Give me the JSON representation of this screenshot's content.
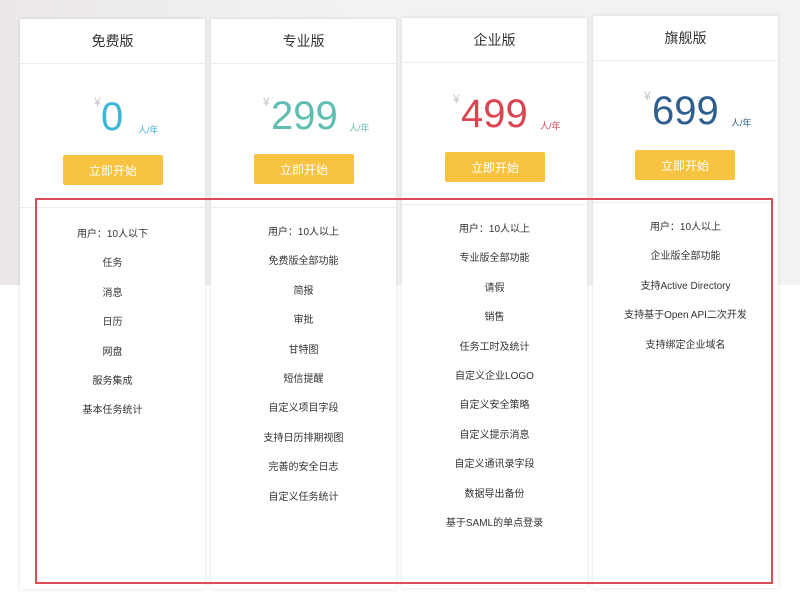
{
  "colors": {
    "free": "#3bb5d8",
    "pro": "#5fbdb1",
    "enterprise": "#d94652",
    "flagship": "#2d5f8f",
    "button": "#f7c341",
    "highlight_border": "#db4c58"
  },
  "plans": [
    {
      "name": "免费版",
      "currency": "¥",
      "price": "0",
      "unit": "人/年",
      "cta": "立即开始",
      "features": [
        "用户：10人以下",
        "任务",
        "消息",
        "日历",
        "网盘",
        "服务集成",
        "基本任务统计"
      ]
    },
    {
      "name": "专业版",
      "currency": "¥",
      "price": "299",
      "unit": "人/年",
      "cta": "立即开始",
      "features": [
        "用户：10人以上",
        "免费版全部功能",
        "简报",
        "审批",
        "甘特图",
        "短信提醒",
        "自定义项目字段",
        "支持日历排期视图",
        "完善的安全日志",
        "自定义任务统计"
      ]
    },
    {
      "name": "企业版",
      "currency": "¥",
      "price": "499",
      "unit": "人/年",
      "cta": "立即开始",
      "features": [
        "用户：10人以上",
        "专业版全部功能",
        "请假",
        "销售",
        "任务工时及统计",
        "自定义企业LOGO",
        "自定义安全策略",
        "自定义提示消息",
        "自定义通讯录字段",
        "数据导出备份",
        "基于SAML的单点登录"
      ]
    },
    {
      "name": "旗舰版",
      "currency": "¥",
      "price": "699",
      "unit": "人/年",
      "cta": "立即开始",
      "features": [
        "用户：10人以上",
        "企业版全部功能",
        "支持Active Directory",
        "支持基于Open API二次开发",
        "支持绑定企业域名"
      ]
    }
  ]
}
